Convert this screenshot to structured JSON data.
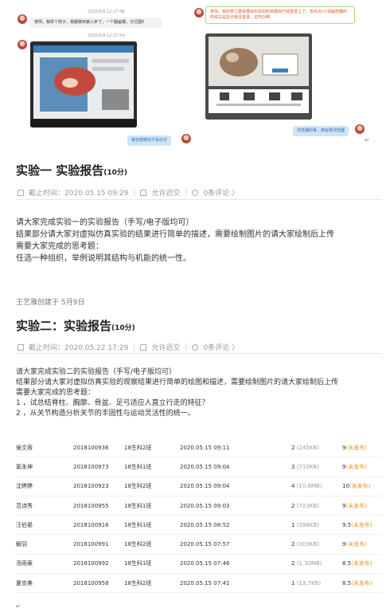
{
  "chat": {
    "timestamp_1": "2020/5/9 12:27:48",
    "message_1": "老师，我举个例子，我都做到第三步了，一个翻盖模，分泛图0",
    "timestamp_2": "2020/5/9 12:27:54",
    "quote_message": "老师，我的梦之路看模拟实验的时候模拟已经登录上了，但点3D人体解剖器的时候总是显示我没登录，这咋办啊",
    "reply_left": "得全部做完才会出分",
    "reply_right": "浏览器的事，用谷歌浏览器",
    "paragraph_mark": "↵"
  },
  "assignment1": {
    "title": "实验一 实验报告",
    "score": "(10分)",
    "deadline": "截止时间：2020.05.15 09:29",
    "late_policy": "允许迟交",
    "comments": "0条评论 〉",
    "lines": [
      "请大家完成实验一的实验报告（手写/电子版均可）",
      "结果部分请大家对虚拟仿真实验的结果进行简单的描述，需要绘制图片的请大家绘制后上传",
      "需要大家完成的思考题：",
      "任选一种组织，举例说明其结构与机能的统一性。"
    ]
  },
  "creator": "王艺雅创建于 5月9日",
  "assignment2": {
    "title": "实验二：实验报告",
    "score": "(10分)",
    "deadline": "截止时间：2020.05.22 17:29",
    "late_policy": "允许迟交",
    "comments": "0条评论 〉",
    "lines": [
      "请大家完成实验二的实验报告（手写/电子版均可）",
      "结果部分请大家对虚拟仿真实验的观察结果进行简单的绘图和描述，需要绘制图片的请大家绘制后上传",
      "需要大家完成的思考题：",
      "1 ，试总结脊柱、胸廓、骨盆、足弓适应人直立行走的特征？",
      "2 ，从关节构造分析关节的丰固性与运动灵活性的统一。"
    ]
  },
  "submissions": [
    {
      "name": "侯文蓉",
      "id": "2018100936",
      "class": "18生科2班",
      "time": "2020.05.15 09:11",
      "files": "2",
      "size": "(245KB)",
      "score": "9",
      "status": "(未发布)"
    },
    {
      "name": "窦永坤",
      "id": "2018100973",
      "class": "18生科1班",
      "time": "2020.05.15 09:04",
      "files": "3",
      "size": "(710KB)",
      "score": "9",
      "status": "(未发布)"
    },
    {
      "name": "沈婷婷",
      "id": "2018100923",
      "class": "18生科2班",
      "time": "2020.05.15 09:04",
      "files": "4",
      "size": "(10.8MB)",
      "score": "10",
      "status": "(未发布)"
    },
    {
      "name": "范诗秀",
      "id": "2018100955",
      "class": "18生科1班",
      "time": "2020.05.15 09:03",
      "files": "2",
      "size": "(723KB)",
      "score": "9",
      "status": "(未发布)"
    },
    {
      "name": "汪伯晏",
      "id": "2018100916",
      "class": "18生科1班",
      "time": "2020.05.15 08:52",
      "files": "1",
      "size": "(288KB)",
      "score": "9.5",
      "status": "(未发布)"
    },
    {
      "name": "解羽",
      "id": "2018100991",
      "class": "18生科2班",
      "time": "2020.05.15 07:57",
      "files": "2",
      "size": "(303KB)",
      "score": "9",
      "status": "(未发布)"
    },
    {
      "name": "汤雨豪",
      "id": "2018100992",
      "class": "18生科1班",
      "time": "2020.05.15 07:46",
      "files": "2",
      "size": "(1.30MB)",
      "score": "8.5",
      "status": "(未发布)"
    },
    {
      "name": "夏京美",
      "id": "2018100958",
      "class": "18生科2班",
      "time": "2020.05.15 07:41",
      "files": "1",
      "size": "(13.7KB)",
      "score": "8.5",
      "status": "(未发布)"
    }
  ]
}
